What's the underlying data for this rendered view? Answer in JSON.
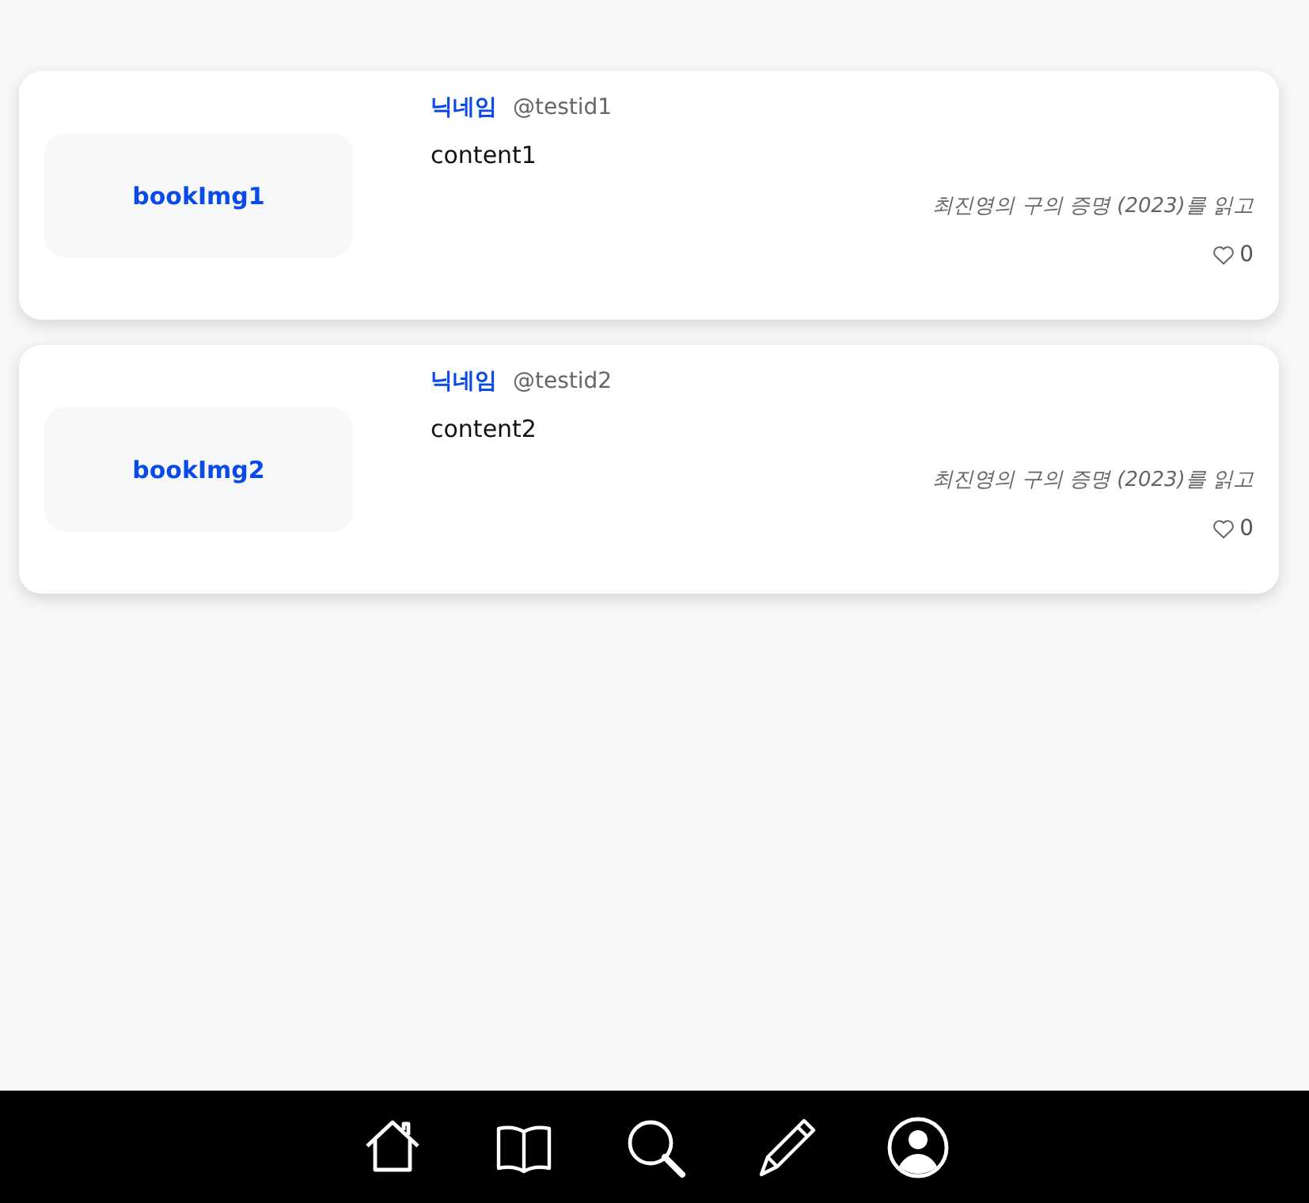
{
  "posts": [
    {
      "image_label": "bookImg1",
      "nickname": "닉네임",
      "user_id": "@testid1",
      "content": "content1",
      "book_note": "최진영의 구의 증명 (2023)를 읽고",
      "liked": false,
      "likes": "0"
    },
    {
      "image_label": "bookImg2",
      "nickname": "닉네임",
      "user_id": "@testid2",
      "content": "content2",
      "book_note": "최진영의 구의 증명 (2023)를 읽고",
      "liked": false,
      "likes": "0"
    }
  ],
  "nav": [
    {
      "kind": "home"
    },
    {
      "kind": "book"
    },
    {
      "kind": "search"
    },
    {
      "kind": "pencil"
    },
    {
      "kind": "profile"
    }
  ]
}
